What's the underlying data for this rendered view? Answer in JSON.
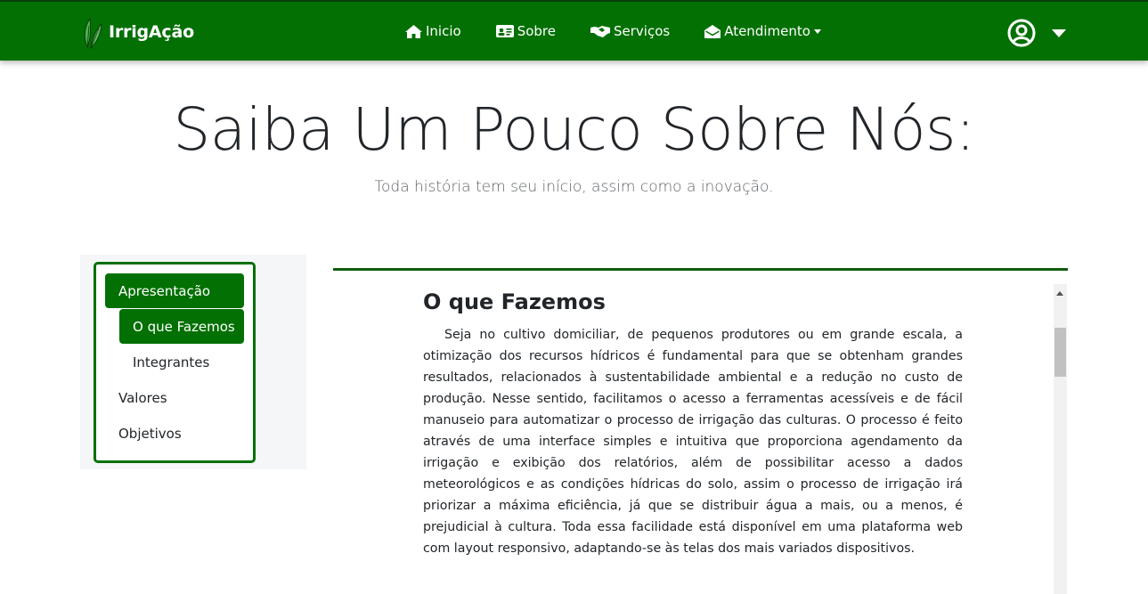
{
  "navbar": {
    "brand": "IrrigAção",
    "items": [
      {
        "label": "Inicio",
        "icon": "home-icon"
      },
      {
        "label": "Sobre",
        "icon": "id-card-icon"
      },
      {
        "label": "Serviços",
        "icon": "handshake-icon"
      },
      {
        "label": "Atendimento",
        "icon": "envelope-open-icon",
        "dropdown": true
      }
    ],
    "user_icon": "user-circle-icon",
    "accent_color": "#037003"
  },
  "hero": {
    "title": "Saiba Um Pouco Sobre Nós:",
    "subtitle": "Toda história tem seu início, assim como a inovação."
  },
  "sidebar": {
    "items": [
      {
        "label": "Apresentação",
        "active": true
      },
      {
        "label": "O que Fazemos",
        "active": true,
        "sub": true
      },
      {
        "label": "Integrantes",
        "active": false,
        "sub": true
      },
      {
        "label": "Valores",
        "active": false
      },
      {
        "label": "Objetivos",
        "active": false
      }
    ]
  },
  "content": {
    "title": "O que Fazemos",
    "paragraph": "Seja no cultivo domiciliar, de pequenos produtores ou em grande escala, a otimização dos recursos hídricos é fundamental para que se obtenham grandes resultados, relacionados à sustentabilidade ambiental e a redução no custo de produção. Nesse sentido, facilitamos o acesso a ferramentas acessíveis e de fácil manuseio para automatizar o processo de irrigação das culturas. O processo é feito através de uma interface simples e intuitiva que proporciona agendamento da irrigação e exibição dos relatórios, além de possibilitar acesso a dados meteorológicos e as condições hídricas do solo, assim o processo de irrigação irá priorizar a máxima eficiência, já que se distribuir água a mais, ou a menos, é prejudicial à cultura. Toda essa facilidade está disponível em uma plataforma web com layout responsivo, adaptando-se às telas dos mais variados dispositivos."
  }
}
